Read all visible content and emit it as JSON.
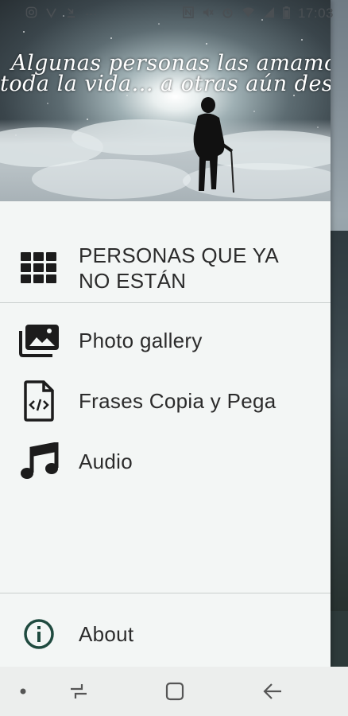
{
  "status_bar": {
    "time": "17:03",
    "left_icons": [
      "instagram-icon",
      "vpn-icon",
      "download-icon",
      "more-dots-icon"
    ],
    "right_icons": [
      "nfc-icon",
      "mute-icon",
      "alarm-icon",
      "wifi-icon",
      "signal-icon",
      "battery-icon"
    ]
  },
  "header": {
    "line1": "Algunas personas las amamos",
    "line2": "toda la vida... a otras aún después"
  },
  "menu": {
    "items": [
      {
        "label": "PERSONAS QUE YA NO ESTÁN",
        "icon": "grid-apps-icon"
      },
      {
        "label": "Photo gallery",
        "icon": "photo-library-icon"
      },
      {
        "label": "Frases Copia y Pega",
        "icon": "code-file-icon"
      },
      {
        "label": "Audio",
        "icon": "music-note-icon"
      }
    ],
    "about": {
      "label": "About",
      "icon": "info-icon"
    }
  },
  "nav_bar": {
    "buttons": [
      "dot-indicator-icon",
      "recent-apps-icon",
      "home-icon",
      "back-icon"
    ]
  },
  "colors": {
    "drawer_bg": "#f3f6f5",
    "text": "#2b2b2b",
    "about_icon": "#1f4a3f"
  }
}
